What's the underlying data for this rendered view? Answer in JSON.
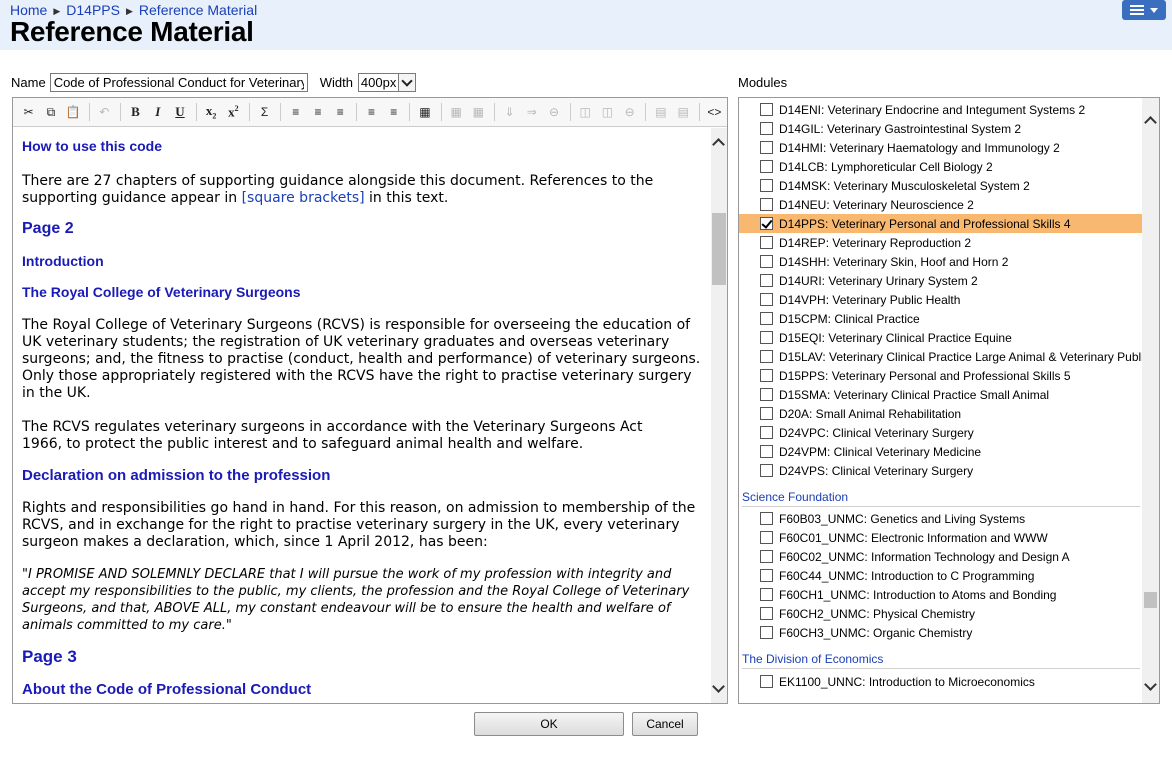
{
  "breadcrumb": {
    "home": "Home",
    "course": "D14PPS",
    "current": "Reference Material"
  },
  "page_title": "Reference Material",
  "form": {
    "name_label": "Name",
    "name_value": "Code of Professional Conduct for Veterinary",
    "width_label": "Width",
    "width_value": "400px"
  },
  "toolbar_icons": [
    "cut-icon",
    "copy-icon",
    "paste-icon",
    "undo-icon",
    "bold-icon",
    "italic-icon",
    "underline-icon",
    "subscript-icon",
    "superscript-icon",
    "sigma-icon",
    "align-left-icon",
    "align-center-icon",
    "align-right-icon",
    "ordered-list-icon",
    "unordered-list-icon",
    "edit-table-icon",
    "table-icon",
    "table-props-icon",
    "insert-row-icon",
    "insert-col-icon",
    "delete-row-icon",
    "merge-icon",
    "split-icon",
    "delete-col-icon",
    "cell-props-icon",
    "row-props-icon",
    "source-code-icon"
  ],
  "content": {
    "h_how": "How to use this code",
    "p_chapters_a": "There are 27 chapters of supporting guidance alongside this document. References to the supporting guidance appear in ",
    "p_chapters_link": "[square brackets]",
    "p_chapters_b": " in this text.",
    "h_page2": "Page 2",
    "h_intro": "Introduction",
    "h_rcvs": "The Royal College of Veterinary Surgeons",
    "p_rcvs": "The Royal College of Veterinary Surgeons (RCVS) is responsible for overseeing the education of UK veterinary students; the registration of UK veterinary graduates and overseas veterinary surgeons; and, the fitness to practise (conduct, health and performance) of veterinary surgeons. Only those appropriately registered with the RCVS have the right to practise veterinary surgery in the UK.",
    "p_regulates": "The RCVS regulates veterinary surgeons in accordance with the Veterinary Surgeons Act 1966, to protect the public interest and to safeguard animal health and welfare.",
    "h_declaration": "Declaration on admission to the profession",
    "p_rights": "Rights and responsibilities go hand in hand. For this reason, on admission to membership of the RCVS, and in exchange for the right to practise veterinary surgery in the UK, every veterinary surgeon makes a declaration, which, since 1 April 2012, has been:",
    "p_quote": "\"I PROMISE AND SOLEMNLY DECLARE that I will pursue the work of my profession with integrity and accept my responsibilities to the public, my clients, the profession and the Royal College of Veterinary Surgeons, and that, ABOVE ALL, my constant endeavour will be to ensure the health and welfare of animals committed to my care.\"",
    "h_page3": "Page 3",
    "h_about": "About the Code of Professional Conduct"
  },
  "modules_label": "Modules",
  "modules": [
    {
      "label": "D14ENI: Veterinary Endocrine and Integument Systems 2",
      "checked": false
    },
    {
      "label": "D14GIL: Veterinary Gastrointestinal System 2",
      "checked": false
    },
    {
      "label": "D14HMI: Veterinary Haematology and Immunology 2",
      "checked": false
    },
    {
      "label": "D14LCB: Lymphoreticular Cell Biology 2",
      "checked": false
    },
    {
      "label": "D14MSK: Veterinary Musculoskeletal System 2",
      "checked": false
    },
    {
      "label": "D14NEU: Veterinary Neuroscience 2",
      "checked": false
    },
    {
      "label": "D14PPS: Veterinary Personal and Professional Skills 4",
      "checked": true
    },
    {
      "label": "D14REP: Veterinary Reproduction 2",
      "checked": false
    },
    {
      "label": "D14SHH: Veterinary Skin, Hoof and Horn 2",
      "checked": false
    },
    {
      "label": "D14URI: Veterinary Urinary System 2",
      "checked": false
    },
    {
      "label": "D14VPH: Veterinary Public Health",
      "checked": false
    },
    {
      "label": "D15CPM: Clinical Practice",
      "checked": false
    },
    {
      "label": "D15EQI: Veterinary Clinical Practice Equine",
      "checked": false
    },
    {
      "label": "D15LAV: Veterinary Clinical Practice Large Animal & Veterinary Publi",
      "checked": false
    },
    {
      "label": "D15PPS: Veterinary Personal and Professional Skills 5",
      "checked": false
    },
    {
      "label": "D15SMA: Veterinary Clinical Practice Small Animal",
      "checked": false
    },
    {
      "label": "D20A: Small Animal Rehabilitation",
      "checked": false
    },
    {
      "label": "D24VPC: Clinical Veterinary Surgery",
      "checked": false
    },
    {
      "label": "D24VPM: Clinical Veterinary Medicine",
      "checked": false
    },
    {
      "label": "D24VPS: Clinical Veterinary Surgery",
      "checked": false
    }
  ],
  "group_science": "Science Foundation",
  "modules_science": [
    {
      "label": "F60B03_UNMC: Genetics and Living Systems",
      "checked": false
    },
    {
      "label": "F60C01_UNMC: Electronic Information and WWW",
      "checked": false
    },
    {
      "label": "F60C02_UNMC: Information Technology and Design A",
      "checked": false
    },
    {
      "label": "F60C44_UNMC: Introduction to C Programming",
      "checked": false
    },
    {
      "label": "F60CH1_UNMC: Introduction to Atoms and Bonding",
      "checked": false
    },
    {
      "label": "F60CH2_UNMC: Physical Chemistry",
      "checked": false
    },
    {
      "label": "F60CH3_UNMC: Organic Chemistry",
      "checked": false
    }
  ],
  "group_economics": "The Division of Economics",
  "modules_economics": [
    {
      "label": "EK1100_UNNC: Introduction to Microeconomics",
      "checked": false
    }
  ],
  "buttons": {
    "ok": "OK",
    "cancel": "Cancel"
  },
  "colors": {
    "header_bg": "#e8f0fb",
    "link": "#1a3fb6",
    "heading": "#1a1ab6",
    "selected_row": "#f9b870",
    "menu_button": "#3a6fc0"
  }
}
